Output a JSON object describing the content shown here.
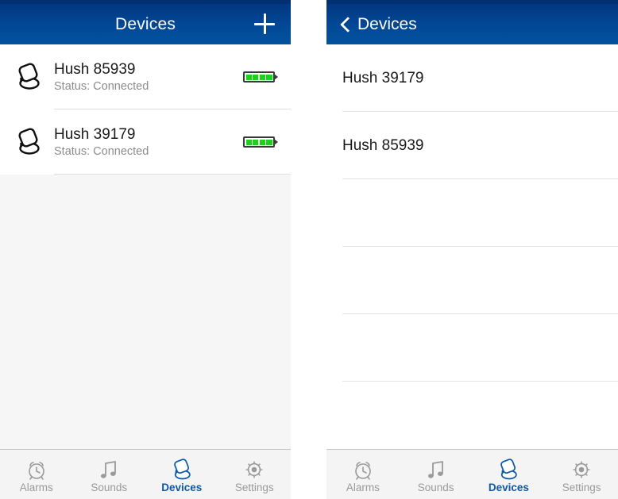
{
  "left_screen": {
    "navbar": {
      "title": "Devices",
      "add_icon": "plus-icon"
    },
    "devices": [
      {
        "icon": "earplug-icon",
        "name": "Hush 85939",
        "status": "Status: Connected",
        "battery_icon": "battery-full-icon",
        "battery_cells": 4
      },
      {
        "icon": "earplug-icon",
        "name": "Hush 39179",
        "status": "Status: Connected",
        "battery_icon": "battery-full-icon",
        "battery_cells": 4
      }
    ],
    "tabbar": [
      {
        "label": "Alarms",
        "icon": "alarm-clock-icon",
        "active": false
      },
      {
        "label": "Sounds",
        "icon": "music-note-icon",
        "active": false
      },
      {
        "label": "Devices",
        "icon": "earplug-icon",
        "active": true
      },
      {
        "label": "Settings",
        "icon": "gear-icon",
        "active": false
      }
    ]
  },
  "right_screen": {
    "navbar": {
      "back_icon": "chevron-left-icon",
      "back_label": "Devices"
    },
    "rows": [
      {
        "name": "Hush 39179"
      },
      {
        "name": "Hush 85939"
      },
      {
        "name": ""
      },
      {
        "name": ""
      },
      {
        "name": ""
      },
      {
        "name": ""
      }
    ],
    "tabbar": [
      {
        "label": "Alarms",
        "icon": "alarm-clock-icon",
        "active": false
      },
      {
        "label": "Sounds",
        "icon": "music-note-icon",
        "active": false
      },
      {
        "label": "Devices",
        "icon": "earplug-icon",
        "active": true
      },
      {
        "label": "Settings",
        "icon": "gear-icon",
        "active": false
      }
    ]
  },
  "colors": {
    "nav_blue_top": "#01347d",
    "nav_blue_bottom": "#02539f",
    "accent": "#0c59a8",
    "battery_green": "#19d219",
    "tab_inactive": "#9a9a9a"
  }
}
